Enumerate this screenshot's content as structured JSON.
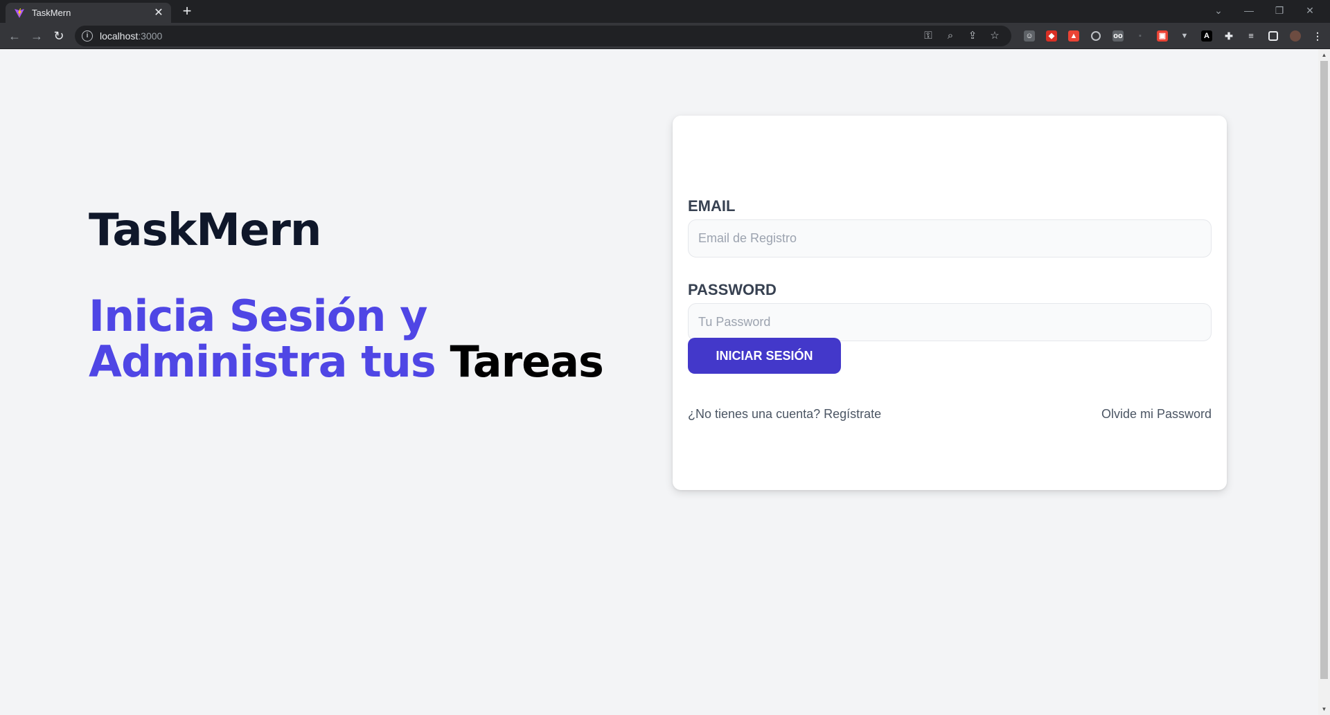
{
  "browser": {
    "tab_title": "TaskMern",
    "url_host": "localhost",
    "url_port": ":3000"
  },
  "page": {
    "brand": "TaskMern",
    "headline_accent_1": "Inicia Sesión y",
    "headline_accent_2": "Administra tus",
    "headline_dark": "Tareas"
  },
  "form": {
    "email_label": "EMAIL",
    "email_placeholder": "Email de Registro",
    "password_label": "PASSWORD",
    "password_placeholder": "Tu Password",
    "submit_label": "INICIAR SESIÓN",
    "register_link": "¿No tienes una cuenta? Regístrate",
    "forgot_link": "Olvide mi Password"
  },
  "colors": {
    "accent": "#4f46e5",
    "button": "#4338ca",
    "background": "#f3f4f6"
  }
}
